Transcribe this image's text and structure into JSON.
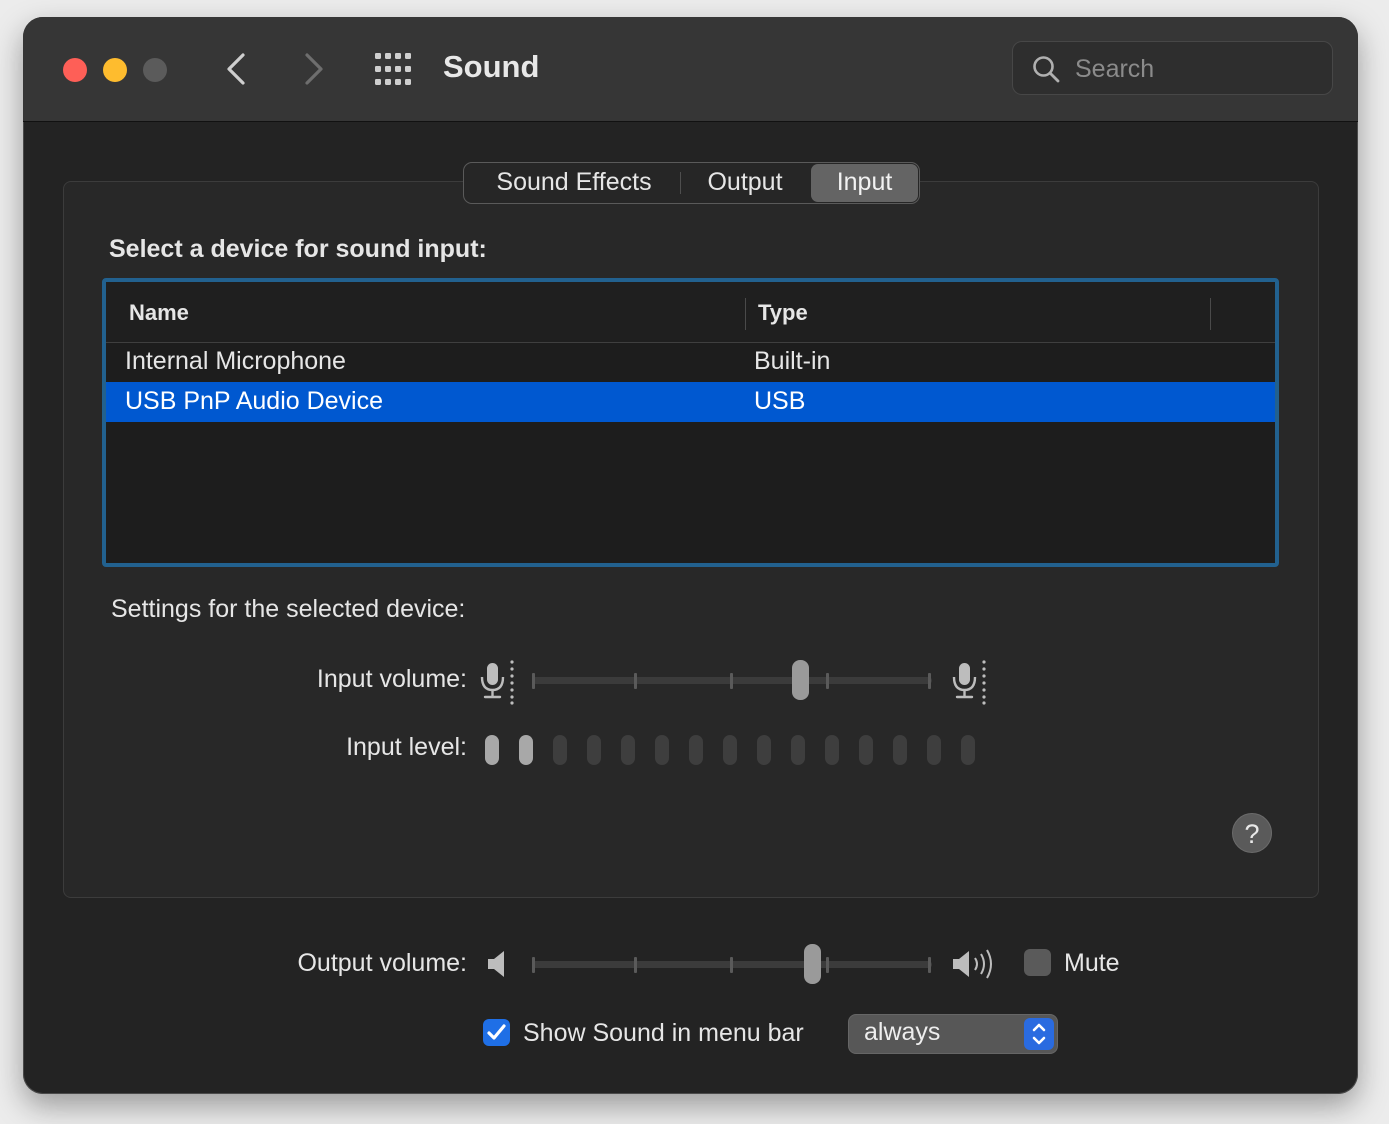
{
  "window": {
    "title": "Sound",
    "search_placeholder": "Search"
  },
  "tabs": [
    {
      "label": "Sound Effects",
      "selected": false
    },
    {
      "label": "Output",
      "selected": false
    },
    {
      "label": "Input",
      "selected": true
    }
  ],
  "input": {
    "select_device_label": "Select a device for sound input:",
    "columns": {
      "name": "Name",
      "type": "Type"
    },
    "devices": [
      {
        "name": "Internal Microphone",
        "type": "Built-in",
        "selected": false
      },
      {
        "name": "USB PnP Audio Device",
        "type": "USB",
        "selected": true
      }
    ],
    "settings_label": "Settings for the selected device:",
    "input_volume_label": "Input volume:",
    "input_volume_percent": 67,
    "input_level_label": "Input level:",
    "input_level_bars_total": 15,
    "input_level_bars_lit": 2
  },
  "output": {
    "volume_label": "Output volume:",
    "volume_percent": 70,
    "mute_label": "Mute",
    "mute_checked": false
  },
  "menu_bar": {
    "show_label": "Show Sound in menu bar",
    "show_checked": true,
    "visibility_value": "always"
  },
  "colors": {
    "selection": "#0058d0",
    "checkbox_on": "#1f6fe6",
    "focus_ring": "#22618f"
  }
}
